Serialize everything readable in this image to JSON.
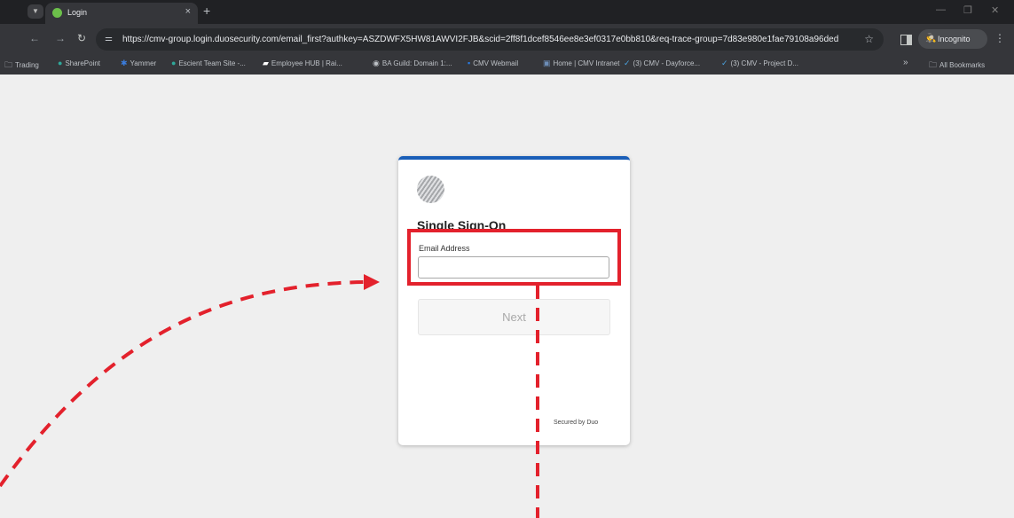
{
  "browser": {
    "tab_title": "Login",
    "tab_close": "×",
    "new_tab": "+",
    "url": "https://cmv-group.login.duosecurity.com/email_first?authkey=ASZDWFX5HW81AWVI2FJB&scid=2ff8f1dcef8546ee8e3ef0317e0bb810&req-trace-group=7d83e980e1fae79108a96ded",
    "incognito_label": "Incognito"
  },
  "bookmarks": [
    {
      "label": "Trading",
      "icon": "folder-icon"
    },
    {
      "label": "SharePoint",
      "icon": "sharepoint-icon"
    },
    {
      "label": "Yammer",
      "icon": "yammer-icon"
    },
    {
      "label": "Escient Team Site -...",
      "icon": "sharepoint-icon"
    },
    {
      "label": "Employee HUB | Rai...",
      "icon": "hub-icon"
    },
    {
      "label": "BA Guild: Domain 1:...",
      "icon": "globe-icon"
    },
    {
      "label": "CMV Webmail",
      "icon": "mail-icon"
    },
    {
      "label": "Home | CMV Intranet",
      "icon": "intranet-icon"
    },
    {
      "label": "(3) CMV - Dayforce...",
      "icon": "check-icon"
    },
    {
      "label": "(3) CMV - Project D...",
      "icon": "check-icon"
    },
    {
      "label": "All Bookmarks",
      "icon": "folder-icon"
    }
  ],
  "login": {
    "title": "Single Sign-On",
    "email_label": "Email Address",
    "email_value": "",
    "next_label": "Next",
    "secured_text": "Secured by Duo"
  },
  "colors": {
    "card_accent": "#1a5eb8",
    "highlight": "#e3212c",
    "background": "#efefef"
  }
}
